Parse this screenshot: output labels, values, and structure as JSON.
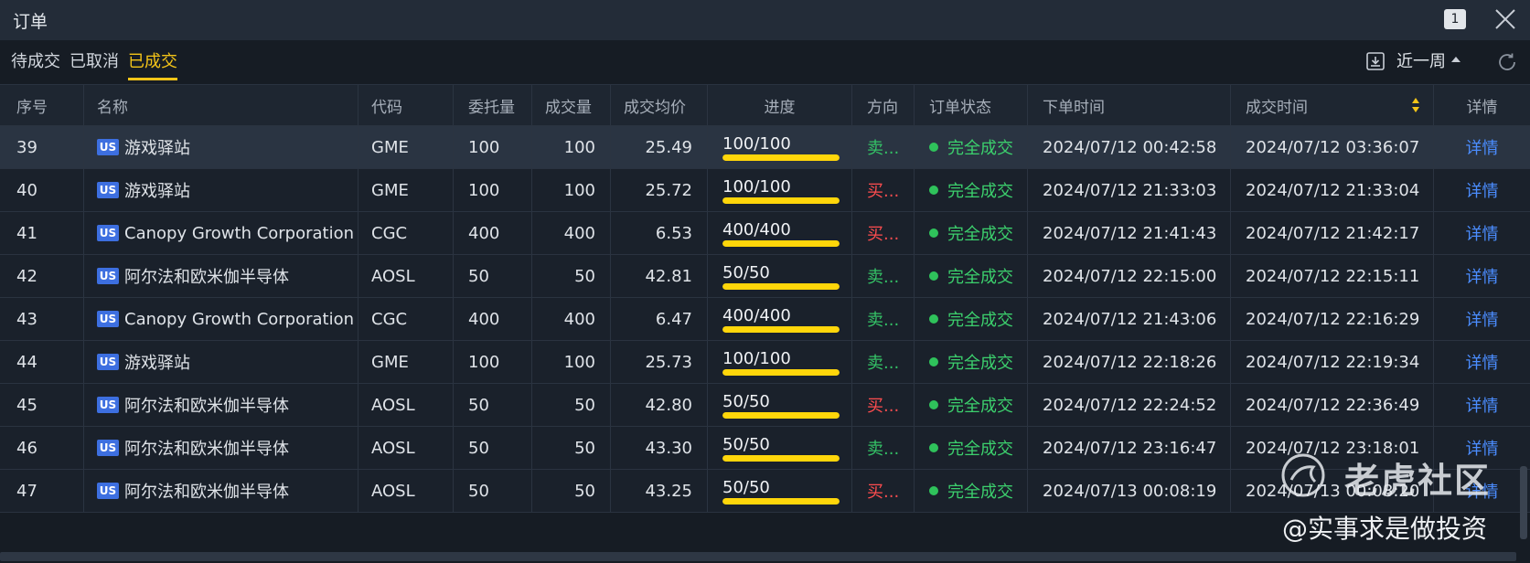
{
  "window": {
    "title": "订单",
    "badge": "1"
  },
  "tabs": [
    {
      "label": "待成交",
      "active": false
    },
    {
      "label": "已取消",
      "active": false
    },
    {
      "label": "已成交",
      "active": true
    }
  ],
  "toolbar": {
    "range_label": "近一周"
  },
  "columns": {
    "idx": "序号",
    "name": "名称",
    "code": "代码",
    "qty": "委托量",
    "filled": "成交量",
    "avg": "成交均价",
    "progress": "进度",
    "direction": "方向",
    "status": "订单状态",
    "order_time": "下单时间",
    "fill_time": "成交时间",
    "detail": "详情"
  },
  "market_badge": "US",
  "rows": [
    {
      "idx": "39",
      "name": "游戏驿站",
      "code": "GME",
      "qty": "100",
      "filled": "100",
      "avg": "25.49",
      "progress": "100/100",
      "progress_pct": 100,
      "direction": "卖...",
      "side": "sell",
      "status": "完全成交",
      "order_time": "2024/07/12 00:42:58",
      "fill_time": "2024/07/12 03:36:07",
      "detail": "详情",
      "selected": true
    },
    {
      "idx": "40",
      "name": "游戏驿站",
      "code": "GME",
      "qty": "100",
      "filled": "100",
      "avg": "25.72",
      "progress": "100/100",
      "progress_pct": 100,
      "direction": "买...",
      "side": "buy",
      "status": "完全成交",
      "order_time": "2024/07/12 21:33:03",
      "fill_time": "2024/07/12 21:33:04",
      "detail": "详情"
    },
    {
      "idx": "41",
      "name": "Canopy Growth Corporation",
      "code": "CGC",
      "qty": "400",
      "filled": "400",
      "avg": "6.53",
      "progress": "400/400",
      "progress_pct": 100,
      "direction": "买...",
      "side": "buy",
      "status": "完全成交",
      "order_time": "2024/07/12 21:41:43",
      "fill_time": "2024/07/12 21:42:17",
      "detail": "详情"
    },
    {
      "idx": "42",
      "name": "阿尔法和欧米伽半导体",
      "code": "AOSL",
      "qty": "50",
      "filled": "50",
      "avg": "42.81",
      "progress": "50/50",
      "progress_pct": 100,
      "direction": "卖...",
      "side": "sell",
      "status": "完全成交",
      "order_time": "2024/07/12 22:15:00",
      "fill_time": "2024/07/12 22:15:11",
      "detail": "详情"
    },
    {
      "idx": "43",
      "name": "Canopy Growth Corporation",
      "code": "CGC",
      "qty": "400",
      "filled": "400",
      "avg": "6.47",
      "progress": "400/400",
      "progress_pct": 100,
      "direction": "卖...",
      "side": "sell",
      "status": "完全成交",
      "order_time": "2024/07/12 21:43:06",
      "fill_time": "2024/07/12 22:16:29",
      "detail": "详情"
    },
    {
      "idx": "44",
      "name": "游戏驿站",
      "code": "GME",
      "qty": "100",
      "filled": "100",
      "avg": "25.73",
      "progress": "100/100",
      "progress_pct": 100,
      "direction": "卖...",
      "side": "sell",
      "status": "完全成交",
      "order_time": "2024/07/12 22:18:26",
      "fill_time": "2024/07/12 22:19:34",
      "detail": "详情"
    },
    {
      "idx": "45",
      "name": "阿尔法和欧米伽半导体",
      "code": "AOSL",
      "qty": "50",
      "filled": "50",
      "avg": "42.80",
      "progress": "50/50",
      "progress_pct": 100,
      "direction": "买...",
      "side": "buy",
      "status": "完全成交",
      "order_time": "2024/07/12 22:24:52",
      "fill_time": "2024/07/12 22:36:49",
      "detail": "详情"
    },
    {
      "idx": "46",
      "name": "阿尔法和欧米伽半导体",
      "code": "AOSL",
      "qty": "50",
      "filled": "50",
      "avg": "43.30",
      "progress": "50/50",
      "progress_pct": 100,
      "direction": "卖...",
      "side": "sell",
      "status": "完全成交",
      "order_time": "2024/07/12 23:16:47",
      "fill_time": "2024/07/12 23:18:01",
      "detail": "详情"
    },
    {
      "idx": "47",
      "name": "阿尔法和欧米伽半导体",
      "code": "AOSL",
      "qty": "50",
      "filled": "50",
      "avg": "43.25",
      "progress": "50/50",
      "progress_pct": 100,
      "direction": "买...",
      "side": "buy",
      "status": "完全成交",
      "order_time": "2024/07/13 00:08:19",
      "fill_time": "2024/07/13 00:08:20",
      "detail": "详情"
    }
  ],
  "watermark": {
    "brand": "老虎社区",
    "handle": "@实事求是做投资"
  },
  "colors": {
    "accent": "#f5c518",
    "sell": "#34c266",
    "buy": "#ff4d4f",
    "link": "#4b8dff",
    "progress": "#ffd60a"
  },
  "icons": {
    "close": "close-icon",
    "export": "export-icon",
    "refresh": "refresh-icon",
    "sort": "sort-icon"
  }
}
